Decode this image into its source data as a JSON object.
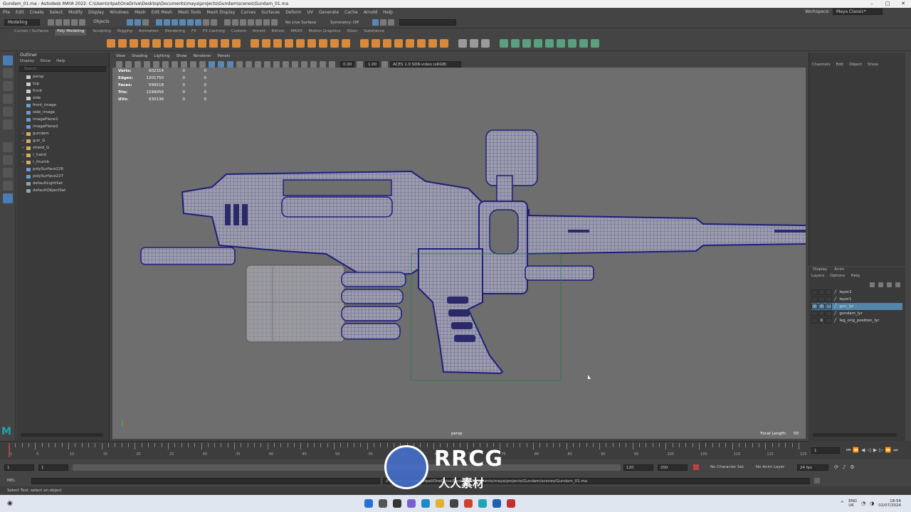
{
  "window": {
    "title": "Gundam_01.ma - Autodesk MAYA 2022: C:\\Users\\ntpal\\OneDrive\\Desktop\\Documents\\maya\\projects\\Gundam\\scenes\\Gundam_01.ma",
    "controls": [
      "–",
      "□",
      "✕"
    ]
  },
  "menubar": {
    "items": [
      "File",
      "Edit",
      "Create",
      "Select",
      "Modify",
      "Display",
      "Windows",
      "Mesh",
      "Edit Mesh",
      "Mesh Tools",
      "Mesh Display",
      "Curves",
      "Surfaces",
      "Deform",
      "UV",
      "Generate",
      "Cache",
      "Arnold",
      "Help"
    ],
    "workspace_label": "Workspace:",
    "workspace_value": "Maya Classic*"
  },
  "statusline": {
    "mode": "Modeling",
    "selection_mask": "Objects",
    "live_surface": "No Live Surface",
    "symmetry": "Symmetry: Off"
  },
  "shelf": {
    "tabs": [
      "Curves / Surfaces",
      "Poly Modeling",
      "Sculpting",
      "Rigging",
      "Animation",
      "Rendering",
      "FX",
      "FX Caching",
      "Custom",
      "Arnold",
      "Bifrost",
      "MASH",
      "Motion Graphics",
      "XGen",
      "Substance"
    ],
    "active_tab": "Poly Modeling"
  },
  "outliner": {
    "title": "Outliner",
    "menu": [
      "Display",
      "Show",
      "Help"
    ],
    "search_placeholder": "Search...",
    "items": [
      {
        "label": "persp",
        "type": "cam",
        "expandable": false
      },
      {
        "label": "top",
        "type": "cam",
        "expandable": false
      },
      {
        "label": "front",
        "type": "cam",
        "expandable": false
      },
      {
        "label": "side",
        "type": "cam",
        "expandable": false
      },
      {
        "label": "front_image",
        "type": "mesh",
        "expandable": false
      },
      {
        "label": "side_image",
        "type": "mesh",
        "expandable": false
      },
      {
        "label": "imagePlane1",
        "type": "mesh",
        "expandable": false
      },
      {
        "label": "imagePlane2",
        "type": "mesh",
        "expandable": false
      },
      {
        "label": "gundam",
        "type": "grp",
        "expandable": true
      },
      {
        "label": "gun_G",
        "type": "grp",
        "expandable": true
      },
      {
        "label": "shield_G",
        "type": "grp",
        "expandable": true
      },
      {
        "label": "r_hand",
        "type": "grp",
        "expandable": true
      },
      {
        "label": "r_thumb",
        "type": "grp",
        "expandable": true
      },
      {
        "label": "polySurface226",
        "type": "mesh",
        "expandable": false
      },
      {
        "label": "polySurface227",
        "type": "mesh",
        "expandable": false
      },
      {
        "label": "defaultLightSet",
        "type": "set",
        "expandable": false
      },
      {
        "label": "defaultObjectSet",
        "type": "set",
        "expandable": false
      }
    ]
  },
  "viewport": {
    "menu": [
      "View",
      "Shading",
      "Lighting",
      "Show",
      "Renderer",
      "Panels"
    ],
    "exposure": "0.00",
    "gamma": "1.00",
    "color_space": "ACES 1.0 SDR-video (sRGB)",
    "hud": [
      {
        "label": "Verts:",
        "a": "602314",
        "b": "0",
        "c": "0"
      },
      {
        "label": "Edges:",
        "a": "1201750",
        "b": "0",
        "c": "0"
      },
      {
        "label": "Faces:",
        "a": "599518",
        "b": "0",
        "c": "0"
      },
      {
        "label": "Tris:",
        "a": "1199056",
        "b": "0",
        "c": "0"
      },
      {
        "label": "UVs:",
        "a": "630136",
        "b": "0",
        "c": "0"
      }
    ],
    "camera": "persp",
    "focal_label": "Focal Length:",
    "focal_value": "50"
  },
  "channelbox": {
    "menu": [
      "Channels",
      "Edit",
      "Object",
      "Show"
    ]
  },
  "layers": {
    "tabs": [
      "Display",
      "Anim"
    ],
    "menu": [
      "Layers",
      "Options",
      "Help"
    ],
    "items": [
      {
        "name": "layer2",
        "v": "",
        "p": "",
        "selected": false
      },
      {
        "name": "layer1",
        "v": "",
        "p": "",
        "selected": false
      },
      {
        "name": "gun_lyr",
        "v": "V",
        "p": "P",
        "selected": true
      },
      {
        "name": "gundam_lyr",
        "v": "",
        "p": "",
        "selected": false
      },
      {
        "name": "leg_orig_position_lyr",
        "v": "",
        "p": "R",
        "selected": false
      }
    ]
  },
  "timeslider": {
    "ticks": [
      "1",
      "5",
      "10",
      "15",
      "20",
      "25",
      "30",
      "35",
      "40",
      "45",
      "50",
      "55",
      "60",
      "65",
      "70",
      "75",
      "80",
      "85",
      "90",
      "95",
      "100",
      "105",
      "110",
      "115",
      "120"
    ],
    "current_frame": "1"
  },
  "rangeslider": {
    "start": "1",
    "inner_start": "1",
    "inner_end": "120",
    "end": "200",
    "character_set": "No Character Set",
    "anim_layer": "No Anim Layer",
    "fps": "24 fps"
  },
  "cmdline": {
    "label": "MEL",
    "result": "// Result: C:/Users/ntpal/OneDrive/Desktop/Documents/maya/projects/Gundam/scenes/Gundam_01.ma"
  },
  "helpline": {
    "text": "Select Tool: select an object"
  },
  "taskbar": {
    "lang": "ENG",
    "region": "UK",
    "time": "18:56",
    "date": "02/07/2024"
  },
  "watermark": {
    "brand": "RRCG",
    "sub": "人人素材"
  },
  "colors": {
    "viewport_bg": "#6e6e6e",
    "mesh_fill": "#9a9aa6",
    "wire_selected": "#1e1e7a",
    "layer_selected": "#5285a6",
    "shelf_orange": "#d8893a",
    "accent_blue": "#4a7db5"
  }
}
